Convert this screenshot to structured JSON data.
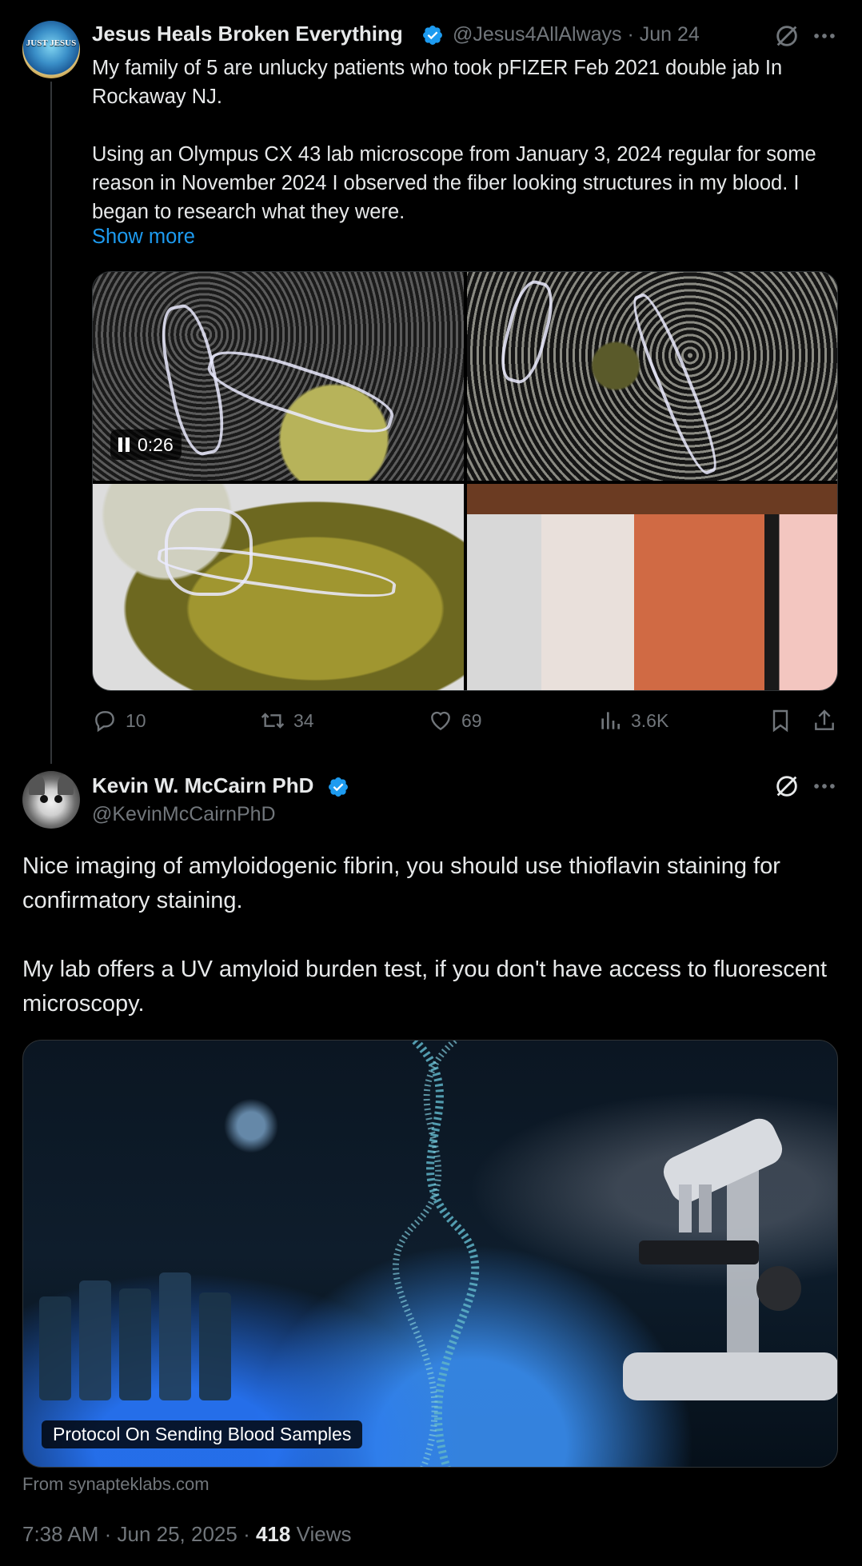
{
  "tweet1": {
    "author_name": "Jesus Heals Broken Everything",
    "handle_and_date": "@Jesus4AllAlways · Jun 24",
    "avatar_text": "JUST JESUS",
    "text": "My family of 5 are unlucky patients who took pFIZER Feb 2021 double jab In Rockaway NJ.\n\nUsing an Olympus CX 43 lab microscope from January 3, 2024 regular for some reason in November 2024 I observed the fiber looking structures in my blood. I began to research what they were.",
    "show_more": "Show more",
    "video_time": "0:26",
    "actions": {
      "replies": "10",
      "reposts": "34",
      "likes": "69",
      "views": "3.6K"
    }
  },
  "tweet2": {
    "author_name": "Kevin W. McCairn PhD",
    "handle": "@KevinMcCairnPhD",
    "text": "Nice imaging of amyloidogenic fibrin, you should use thioflavin staining for confirmatory staining.\n\nMy lab offers a UV amyloid burden test, if you don't have access to fluorescent microscopy.",
    "card": {
      "label": "Protocol On Sending Blood Samples",
      "source": "From synapteklabs.com"
    },
    "meta": {
      "time_date": "7:38 AM · Jun 25, 2025 · ",
      "views_count": "418",
      "views_label": " Views"
    }
  },
  "colors": {
    "background": "#000000",
    "text": "#e7e9ea",
    "secondary": "#71767b",
    "link": "#1d9bf0",
    "verified": "#1d9bf0"
  },
  "icons": [
    "verified-badge-icon",
    "grok-icon",
    "more-icon",
    "reply-icon",
    "repost-icon",
    "like-icon",
    "views-icon",
    "bookmark-icon",
    "share-icon",
    "pause-icon"
  ]
}
